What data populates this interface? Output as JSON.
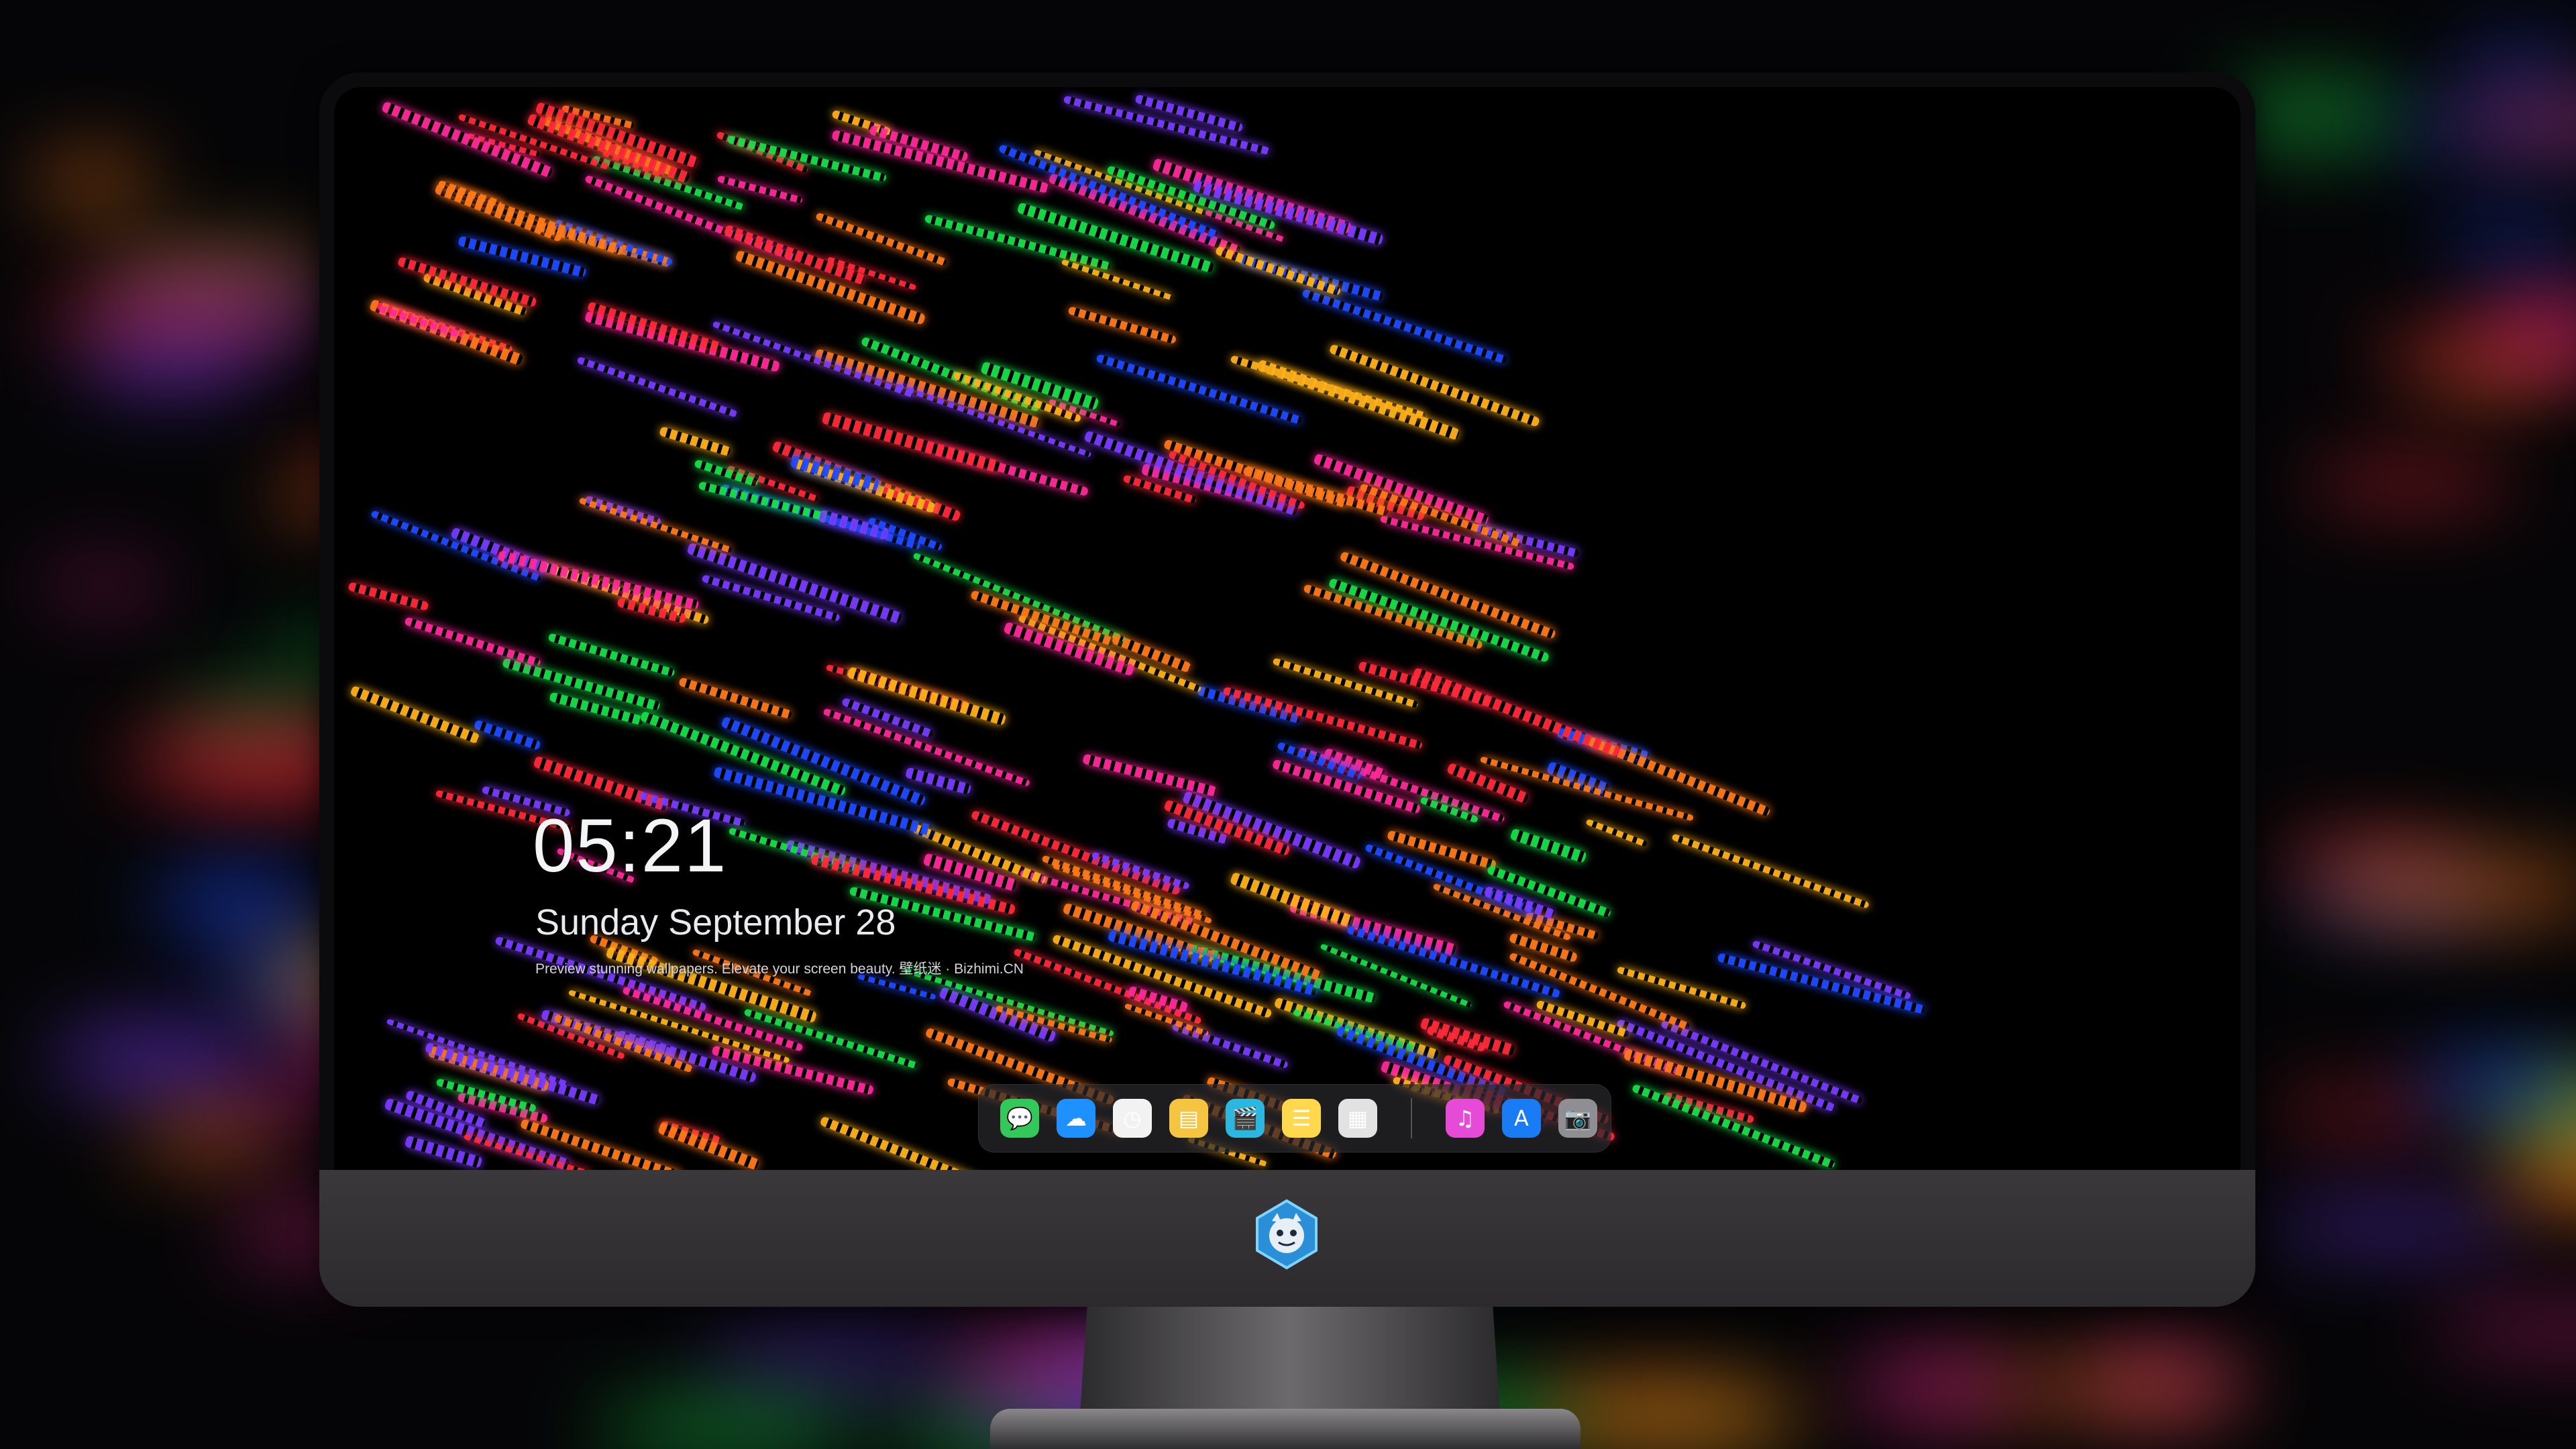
{
  "lockscreen": {
    "time": "05:21",
    "date": "Sunday September 28",
    "tagline": "Preview stunning wallpapers. Elevate your screen beauty. 壁纸迷 · Bizhimi.CN"
  },
  "dock": {
    "apps": [
      {
        "name": "messages-icon",
        "glyph": "💬",
        "color": "#34c759"
      },
      {
        "name": "weather-icon",
        "glyph": "☁",
        "color": "#1e90ff"
      },
      {
        "name": "clock-icon",
        "glyph": "◷",
        "color": "#f2f2f2"
      },
      {
        "name": "preview-icon",
        "glyph": "▤",
        "color": "#f5c542"
      },
      {
        "name": "clips-icon",
        "glyph": "🎬",
        "color": "#2bb8e0"
      },
      {
        "name": "notes-icon",
        "glyph": "☰",
        "color": "#ffd84d"
      },
      {
        "name": "photo-booth-icon",
        "glyph": "▦",
        "color": "#e2e2e2"
      }
    ],
    "apps_right": [
      {
        "name": "music-icon",
        "glyph": "♫",
        "color": "#e64bd8"
      },
      {
        "name": "app-store-icon",
        "glyph": "A",
        "color": "#1a7cf5"
      },
      {
        "name": "camera-icon",
        "glyph": "📷",
        "color": "#8e8e93"
      }
    ]
  },
  "colors": {
    "streaks": [
      "#ff2b3a",
      "#1f4bff",
      "#19e04a",
      "#ffb21a",
      "#ff7a1a",
      "#7a3dff",
      "#ff2b9a"
    ]
  }
}
